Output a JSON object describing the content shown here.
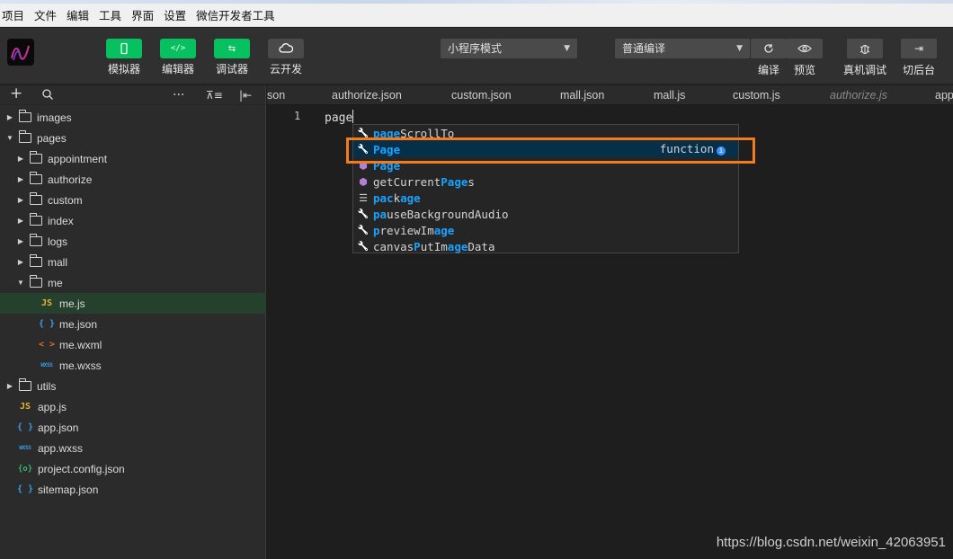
{
  "menubar": [
    "项目",
    "文件",
    "编辑",
    "工具",
    "界面",
    "设置",
    "微信开发者工具"
  ],
  "toolbar": {
    "simulator": "模拟器",
    "editor": "编辑器",
    "debugger": "调试器",
    "cloud": "云开发",
    "mode_select": "小程序模式",
    "compile_select": "普通编译",
    "compile": "编译",
    "preview": "预览",
    "real_debug": "真机调试",
    "background": "切后台"
  },
  "sidebar": {
    "tree": [
      {
        "label": "images",
        "kind": "folder",
        "expanded": false,
        "depth": 0
      },
      {
        "label": "pages",
        "kind": "folder",
        "expanded": true,
        "depth": 0
      },
      {
        "label": "appointment",
        "kind": "folder",
        "expanded": false,
        "depth": 1
      },
      {
        "label": "authorize",
        "kind": "folder",
        "expanded": false,
        "depth": 1
      },
      {
        "label": "custom",
        "kind": "folder",
        "expanded": false,
        "depth": 1
      },
      {
        "label": "index",
        "kind": "folder",
        "expanded": false,
        "depth": 1
      },
      {
        "label": "logs",
        "kind": "folder",
        "expanded": false,
        "depth": 1
      },
      {
        "label": "mall",
        "kind": "folder",
        "expanded": false,
        "depth": 1
      },
      {
        "label": "me",
        "kind": "folder",
        "expanded": true,
        "depth": 1
      },
      {
        "label": "me.js",
        "kind": "js",
        "depth": 2,
        "selected": true
      },
      {
        "label": "me.json",
        "kind": "json",
        "depth": 2
      },
      {
        "label": "me.wxml",
        "kind": "wxml",
        "depth": 2
      },
      {
        "label": "me.wxss",
        "kind": "wxss",
        "depth": 2
      },
      {
        "label": "utils",
        "kind": "folder",
        "expanded": false,
        "depth": 0
      },
      {
        "label": "app.js",
        "kind": "js",
        "depth": 0
      },
      {
        "label": "app.json",
        "kind": "json",
        "depth": 0
      },
      {
        "label": "app.wxss",
        "kind": "wxss",
        "depth": 0
      },
      {
        "label": "project.config.json",
        "kind": "cfg",
        "depth": 0
      },
      {
        "label": "sitemap.json",
        "kind": "json",
        "depth": 0
      }
    ]
  },
  "icons": {
    "js": "JS",
    "json": "{ }",
    "wxml": "< >",
    "wxss": "WXSS",
    "cfg": "{o}"
  },
  "tabs": [
    "son",
    "authorize.json",
    "custom.json",
    "mall.json",
    "mall.js",
    "custom.js",
    "authorize.js",
    "app"
  ],
  "editor": {
    "line_number": "1",
    "code": "page"
  },
  "suggestions": [
    {
      "pre": "",
      "hl": "page",
      "post": "ScrollTo",
      "icon": "wrench"
    },
    {
      "pre": "",
      "hl": "Page",
      "post": "",
      "icon": "wrench",
      "detail": "function",
      "active": true
    },
    {
      "pre": "",
      "hl": "Page",
      "post": "",
      "icon": "cube"
    },
    {
      "pre": "getCurrent",
      "hl": "Page",
      "post": "s",
      "icon": "cube"
    },
    {
      "pre": "",
      "hl": "pac",
      "post": "k",
      "hl2": "age",
      "icon": "snippet"
    },
    {
      "pre": "",
      "hl": "pa",
      "post": "useBackgroundAudio",
      "icon": "wrench"
    },
    {
      "pre": "",
      "hl": "p",
      "post": "reviewIm",
      "hl2": "age",
      "icon": "wrench"
    },
    {
      "pre": "canvas",
      "hl": "P",
      "post": "utIm",
      "hl2": "age",
      "post2": "Data",
      "icon": "wrench"
    }
  ],
  "watermark": "https://blog.csdn.net/weixin_42063951",
  "colors": {
    "accent_green": "#07c160",
    "highlight_orange": "#f07c1e",
    "match_blue": "#18a3ff",
    "selected_row": "#062f4a"
  }
}
